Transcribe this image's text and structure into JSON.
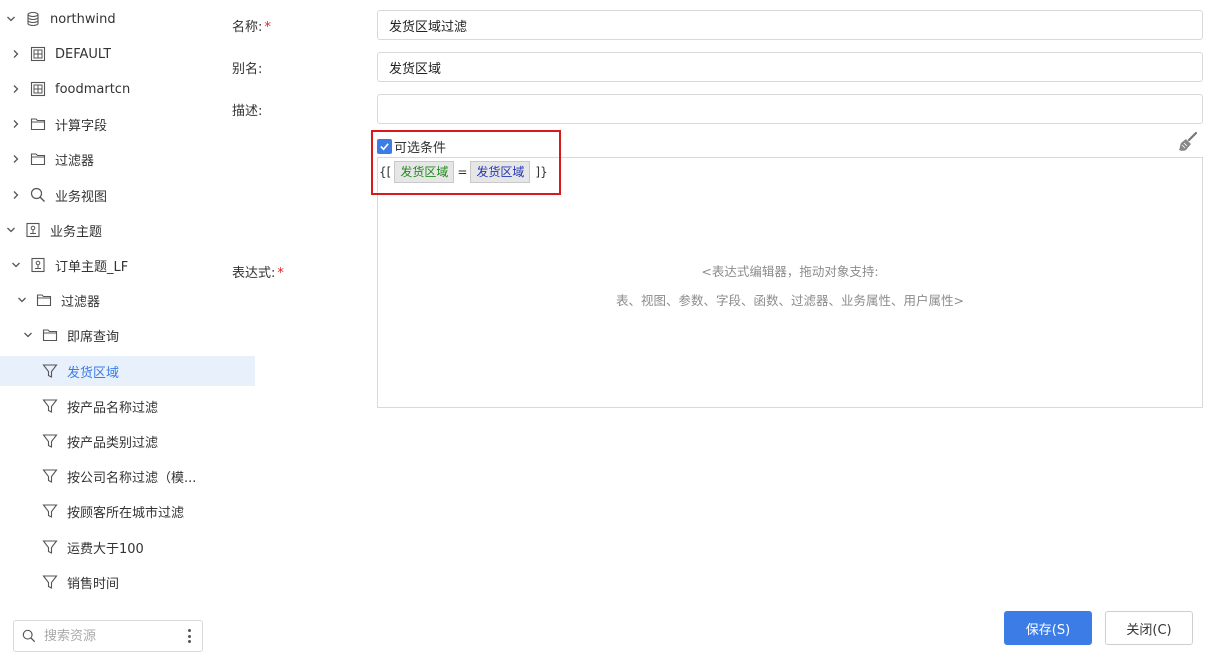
{
  "sidebar": {
    "tree": [
      {
        "label": "northwind",
        "icon": "database-icon",
        "expanded": true
      },
      {
        "label": "DEFAULT",
        "icon": "schema-icon",
        "expanded": false
      },
      {
        "label": "foodmartcn",
        "icon": "schema-icon",
        "expanded": false
      },
      {
        "label": "计算字段",
        "icon": "folder-icon",
        "expanded": false
      },
      {
        "label": "过滤器",
        "icon": "folder-icon",
        "expanded": false
      },
      {
        "label": "业务视图",
        "icon": "search-icon",
        "expanded": false
      },
      {
        "label": "业务主题",
        "icon": "business-theme-icon",
        "expanded": true
      },
      {
        "label": "订单主题_LF",
        "icon": "business-theme-icon",
        "expanded": true
      },
      {
        "label": "过滤器",
        "icon": "folder-icon",
        "expanded": true
      },
      {
        "label": "即席查询",
        "icon": "folder-icon",
        "expanded": true
      },
      {
        "label": "发货区域",
        "icon": "filter-icon",
        "selected": true
      },
      {
        "label": "按产品名称过滤",
        "icon": "filter-icon"
      },
      {
        "label": "按产品类别过滤",
        "icon": "filter-icon"
      },
      {
        "label": "按公司名称过滤（模...",
        "icon": "filter-icon"
      },
      {
        "label": "按顾客所在城市过滤",
        "icon": "filter-icon"
      },
      {
        "label": "运费大于100",
        "icon": "filter-icon"
      },
      {
        "label": "销售时间",
        "icon": "filter-icon"
      }
    ],
    "search": {
      "placeholder": "搜索资源"
    }
  },
  "form": {
    "name": {
      "label": "名称:",
      "required_mark": "*",
      "value": "发货区域过滤"
    },
    "alias": {
      "label": "别名:",
      "value": "发货区域"
    },
    "description": {
      "label": "描述:",
      "value": ""
    },
    "optional_condition": {
      "label": "可选条件",
      "checked": true
    },
    "expression": {
      "label": "表达式:",
      "required_mark": "*",
      "open": "{[",
      "token_left": "发货区域",
      "operator": "=",
      "token_right": "发货区域",
      "close": "]}",
      "hint_line1": "<表达式编辑器，拖动对象支持:",
      "hint_line2": "表、视图、参数、字段、函数、过滤器、业务属性、用户属性>"
    }
  },
  "buttons": {
    "save": "保存(S)",
    "close": "关闭(C)"
  },
  "colors": {
    "accent": "#3c7ce6",
    "required": "#e02020",
    "highlight": "#d91a1a",
    "selected_bg": "#e8f0fc"
  }
}
